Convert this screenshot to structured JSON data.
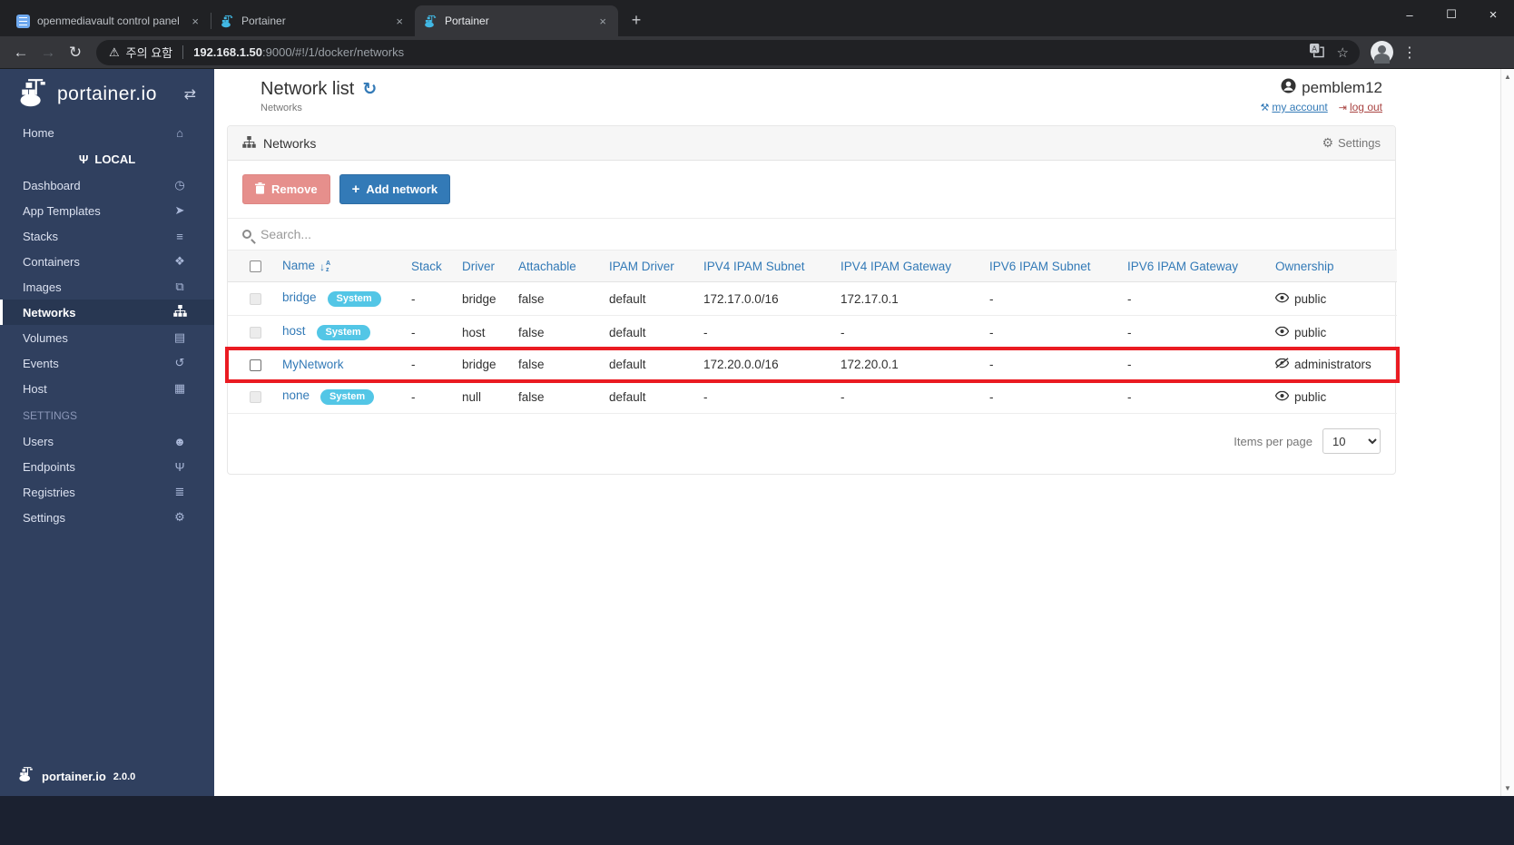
{
  "browser": {
    "tabs": [
      {
        "title": "openmediavault control panel -",
        "favicon": "openmediavault",
        "active": false
      },
      {
        "title": "Portainer",
        "favicon": "portainer",
        "active": false
      },
      {
        "title": "Portainer",
        "favicon": "portainer",
        "active": true
      }
    ],
    "address_bar": {
      "security_warning": "주의 요함",
      "host": "192.168.1.50",
      "path": ":9000/#!/1/docker/networks"
    }
  },
  "sidebar": {
    "logo_text": "portainer.io",
    "items": [
      {
        "label": "Home",
        "icon": "home-icon",
        "type": "item"
      },
      {
        "label": "LOCAL",
        "icon": "plug-icon",
        "type": "endpoint-header"
      },
      {
        "label": "Dashboard",
        "icon": "dashboard-icon",
        "type": "item"
      },
      {
        "label": "App Templates",
        "icon": "rocket-icon",
        "type": "item"
      },
      {
        "label": "Stacks",
        "icon": "stacks-icon",
        "type": "item"
      },
      {
        "label": "Containers",
        "icon": "containers-icon",
        "type": "item"
      },
      {
        "label": "Images",
        "icon": "images-icon",
        "type": "item"
      },
      {
        "label": "Networks",
        "icon": "networks-icon",
        "type": "item",
        "active": true
      },
      {
        "label": "Volumes",
        "icon": "volumes-icon",
        "type": "item"
      },
      {
        "label": "Events",
        "icon": "events-icon",
        "type": "item"
      },
      {
        "label": "Host",
        "icon": "host-icon",
        "type": "item"
      },
      {
        "label": "SETTINGS",
        "type": "section-header"
      },
      {
        "label": "Users",
        "icon": "users-icon",
        "type": "item"
      },
      {
        "label": "Endpoints",
        "icon": "endpoints-icon",
        "type": "item"
      },
      {
        "label": "Registries",
        "icon": "registries-icon",
        "type": "item"
      },
      {
        "label": "Settings",
        "icon": "settings-icon",
        "type": "item"
      }
    ],
    "footer": {
      "logo_text": "portainer.io",
      "version": "2.0.0"
    }
  },
  "page_header": {
    "title": "Network list",
    "breadcrumb": "Networks"
  },
  "user_menu": {
    "username": "pemblem12",
    "my_account": "my account",
    "log_out": "log out"
  },
  "networks_panel": {
    "title": "Networks",
    "settings_label": "Settings",
    "buttons": {
      "remove": "Remove",
      "add_network": "Add network"
    },
    "search_placeholder": "Search...",
    "table": {
      "columns": [
        "Name",
        "Stack",
        "Driver",
        "Attachable",
        "IPAM Driver",
        "IPV4 IPAM Subnet",
        "IPV4 IPAM Gateway",
        "IPV6 IPAM Subnet",
        "IPV6 IPAM Gateway",
        "Ownership"
      ],
      "rows": [
        {
          "name": "bridge",
          "badge": "System",
          "stack": "-",
          "driver": "bridge",
          "attachable": "false",
          "ipam_driver": "default",
          "ipv4_ipam_subnet": "172.17.0.0/16",
          "ipv4_ipam_gateway": "172.17.0.1",
          "ipv6_ipam_subnet": "-",
          "ipv6_ipam_gateway": "-",
          "ownership": "public",
          "ownership_icon": "eye-icon",
          "checkbox_disabled": true,
          "highlighted": false
        },
        {
          "name": "host",
          "badge": "System",
          "stack": "-",
          "driver": "host",
          "attachable": "false",
          "ipam_driver": "default",
          "ipv4_ipam_subnet": "-",
          "ipv4_ipam_gateway": "-",
          "ipv6_ipam_subnet": "-",
          "ipv6_ipam_gateway": "-",
          "ownership": "public",
          "ownership_icon": "eye-icon",
          "checkbox_disabled": true,
          "highlighted": false
        },
        {
          "name": "MyNetwork",
          "badge": null,
          "stack": "-",
          "driver": "bridge",
          "attachable": "false",
          "ipam_driver": "default",
          "ipv4_ipam_subnet": "172.20.0.0/16",
          "ipv4_ipam_gateway": "172.20.0.1",
          "ipv6_ipam_subnet": "-",
          "ipv6_ipam_gateway": "-",
          "ownership": "administrators",
          "ownership_icon": "eye-slash-icon",
          "checkbox_disabled": false,
          "highlighted": true
        },
        {
          "name": "none",
          "badge": "System",
          "stack": "-",
          "driver": "null",
          "attachable": "false",
          "ipam_driver": "default",
          "ipv4_ipam_subnet": "-",
          "ipv4_ipam_gateway": "-",
          "ipv6_ipam_subnet": "-",
          "ipv6_ipam_gateway": "-",
          "ownership": "public",
          "ownership_icon": "eye-icon",
          "checkbox_disabled": true,
          "highlighted": false
        }
      ]
    },
    "pagination": {
      "label": "Items per page",
      "value": "10"
    }
  },
  "colors": {
    "accent_blue": "#337ab7",
    "sidebar_bg": "#30405f",
    "system_badge": "#53c6e6",
    "highlight_red": "#ea1b22",
    "remove_button": "#e68f8c",
    "chrome_dark": "#202124"
  }
}
